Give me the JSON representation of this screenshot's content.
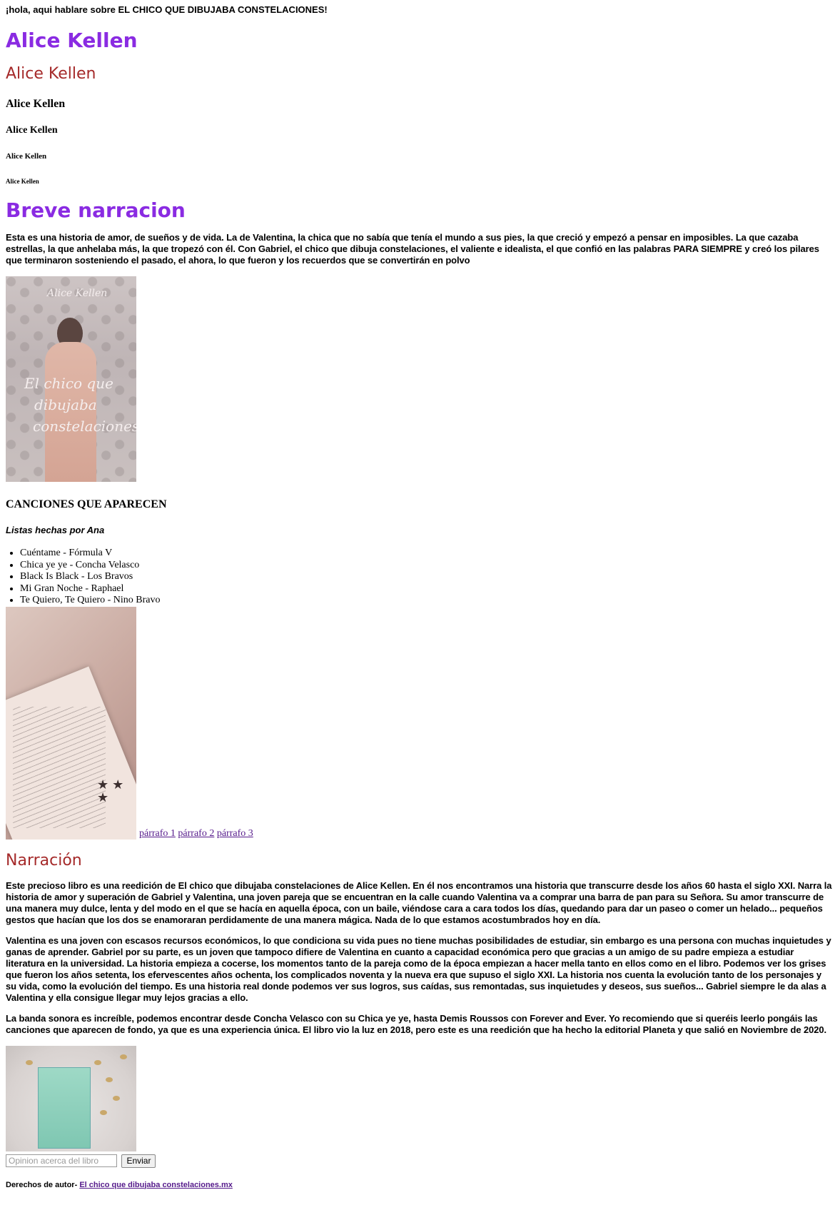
{
  "intro": "¡hola, aqui hablare sobre EL CHICO QUE DIBUJABA CONSTELACIONES!",
  "author_headings": [
    "Alice Kellen",
    "Alice Kellen",
    "Alice Kellen",
    "Alice Kellen",
    "Alice Kellen",
    "Alice Kellen"
  ],
  "breve": {
    "title": "Breve narracion",
    "text": "Esta es una historia de amor, de sueños y de vida. La de Valentina, la chica que no sabía que tenía el mundo a sus pies, la que creció y empezó a pensar en imposibles. La que cazaba estrellas, la que anhelaba más, la que tropezó con él. Con Gabriel, el chico que dibuja constelaciones, el valiente e idealista, el que confió en las palabras PARA SIEMPRE y creó los pilares que terminaron sosteniendo el pasado, el ahora, lo que fueron y los recuerdos que se convertirán en polvo"
  },
  "cover_image": {
    "author_text": "Alice Kellen",
    "lines": [
      "El chico que",
      "dibujaba",
      "constelaciones"
    ]
  },
  "songs": {
    "title": "CANCIONES QUE APARECEN",
    "lists_by": "Listas hechas por Ana",
    "items": [
      "Cuéntame - Fórmula V",
      "Chica ye ye - Concha Velasco",
      "Black Is Black - Los Bravos",
      "Mi Gran Noche - Raphael",
      "Te Quiero, Te Quiero - Nino Bravo"
    ]
  },
  "paragraph_links": [
    "párrafo 1",
    "párrafo 2",
    "párrafo 3"
  ],
  "narracion": {
    "title": "Narración",
    "paragraphs": [
      "Este precioso libro es una reedición de El chico que dibujaba constelaciones de Alice Kellen. En él nos encontramos una historia que transcurre desde los años 60 hasta el siglo XXI. Narra la historia de amor y superación de Gabriel y Valentina, una joven pareja que se encuentran en la calle cuando Valentina va a comprar una barra de pan para su Señora. Su amor transcurre de una manera muy dulce, lenta y del modo en el que se hacía en aquella época, con un baile, viéndose cara a cara todos los días, quedando para dar un paseo o comer un helado... pequeños gestos que hacían que los dos se enamoraran perdidamente de una manera mágica. Nada de lo que estamos acostumbrados hoy en día.",
      "Valentina es una joven con escasos recursos económicos, lo que condiciona su vida pues no tiene muchas posibilidades de estudiar, sin embargo es una persona con muchas inquietudes y ganas de aprender. Gabriel por su parte, es un joven que tampoco difiere de Valentina en cuanto a capacidad económica pero que gracias a un amigo de su padre empieza a estudiar literatura en la universidad. La historia empieza a cocerse, los momentos tanto de la pareja como de la época empiezan a hacer mella tanto en ellos como en el libro. Podemos ver los grises que fueron los años setenta, los efervescentes años ochenta, los complicados noventa y la nueva era que supuso el siglo XXI. La historia nos cuenta la evolución tanto de los personajes y su vida, como la evolución del tiempo. Es una historia real donde podemos ver sus logros, sus caídas, sus remontadas, sus inquietudes y deseos, sus sueños... Gabriel siempre le da alas a Valentina y ella consigue llegar muy lejos gracias a ello.",
      "La banda sonora es increíble, podemos encontrar desde Concha Velasco con su Chica ye ye, hasta Demis Roussos con Forever and Ever. Yo recomiendo que si queréis leerlo pongáis las canciones que aparecen de fondo, ya que es una experiencia única. El libro vio la luz en 2018, pero este es una reedición que ha hecho la editorial Planeta y que salió en Noviembre de 2020."
    ]
  },
  "form": {
    "placeholder": "Opinion acerca del libro",
    "submit": "Enviar"
  },
  "footer": {
    "label": "Derechos de autor-",
    "link": "El chico que dibujaba constelaciones.mx"
  }
}
